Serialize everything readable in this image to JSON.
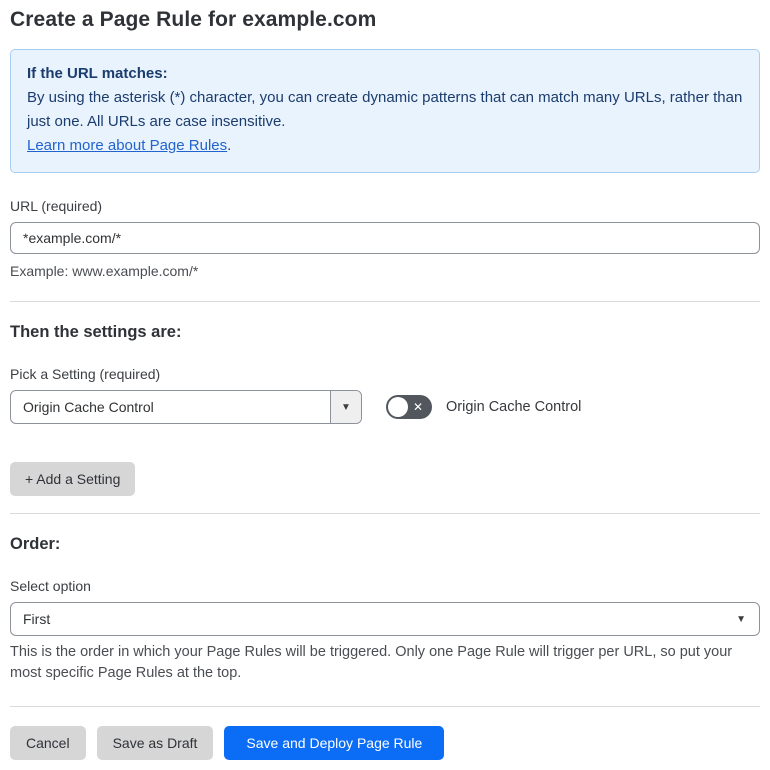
{
  "page": {
    "title": "Create a Page Rule for example.com"
  },
  "info_box": {
    "heading": "If the URL matches:",
    "body": "By using the asterisk (*) character, you can create dynamic patterns that can match many URLs, rather than just one. All URLs are case insensitive.",
    "link_label": "Learn more about Page Rules",
    "link_suffix": "."
  },
  "url_field": {
    "label": "URL (required)",
    "value": "*example.com/*",
    "helper": "Example: www.example.com/*"
  },
  "settings_section": {
    "heading": "Then the settings are:",
    "picker_label": "Pick a Setting (required)",
    "picker_value": "Origin Cache Control",
    "picker_arrow": "▼",
    "toggle_state": "off",
    "toggle_icon": "✕",
    "toggle_label": "Origin Cache Control",
    "add_setting_label": "+ Add a Setting"
  },
  "order_section": {
    "heading": "Order:",
    "select_label": "Select option",
    "select_value": "First",
    "select_arrow": "▼",
    "helper": "This is the order in which your Page Rules will be triggered. Only one Page Rule will trigger per URL, so put your most specific Page Rules at the top."
  },
  "footer": {
    "cancel_label": "Cancel",
    "save_draft_label": "Save as Draft",
    "save_deploy_label": "Save and Deploy Page Rule"
  },
  "colors": {
    "info_bg": "#e9f3fd",
    "info_border": "#a9cdf0",
    "info_text": "#1b3c6e",
    "link": "#2363cd",
    "primary_button": "#0b6df6",
    "gray_button": "#d6d6d6",
    "toggle_off": "#52575d"
  }
}
